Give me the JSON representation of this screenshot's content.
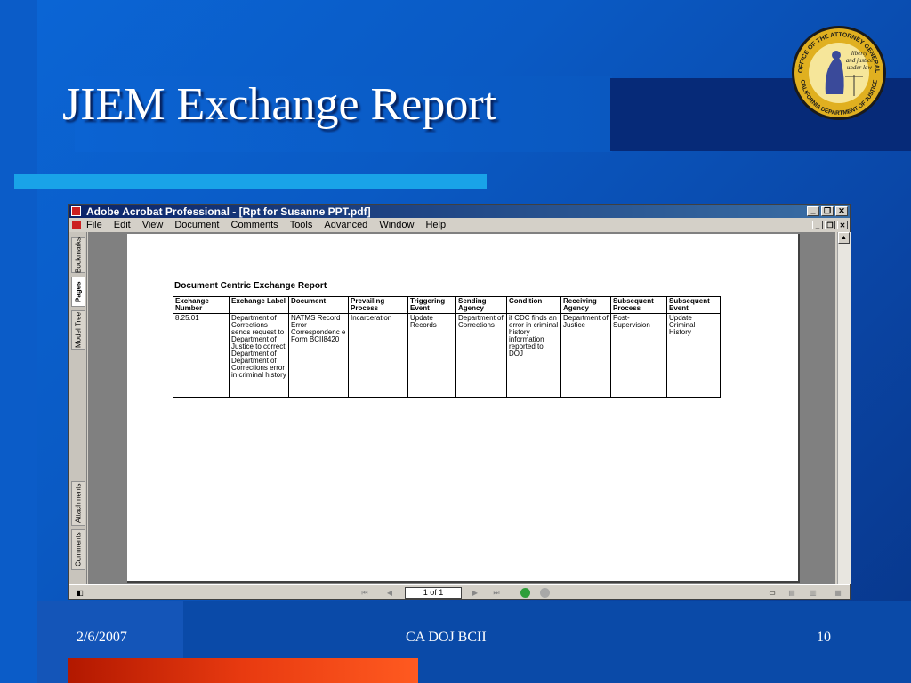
{
  "slide": {
    "title": "JIEM Exchange Report",
    "footer_date": "2/6/2007",
    "footer_center": "CA DOJ BCII",
    "footer_page": "10",
    "seal": {
      "outer_text": "OFFICE OF THE ATTORNEY GENERAL",
      "lower_text": "CALIFORNIA DEPARTMENT OF JUSTICE",
      "motto_1": "liberty",
      "motto_2": "and justice",
      "motto_3": "under law"
    }
  },
  "window": {
    "title": "Adobe Acrobat Professional - [Rpt for Susanne PPT.pdf]",
    "menu": [
      "File",
      "Edit",
      "View",
      "Document",
      "Comments",
      "Tools",
      "Advanced",
      "Window",
      "Help"
    ],
    "nav_tabs": [
      "Bookmarks",
      "Pages",
      "Model Tree",
      "Attachments",
      "Comments"
    ],
    "page_indicator": "1 of 1"
  },
  "report": {
    "title": "Document Centric Exchange Report",
    "headers": [
      "Exchange Number",
      "Exchange Label",
      "Document",
      "Prevailing Process",
      "Triggering Event",
      "Sending Agency",
      "Condition",
      "Receiving Agency",
      "Subsequent Process",
      "Subsequent Event"
    ],
    "row": [
      "8.25.01",
      "Department of Corrections sends request to Department of Justice to correct Department of Department of Corrections error in criminal history",
      "NATMS Record Error Correspondenc e Form BCII8420",
      "Incarceration",
      "Update Records",
      "Department of Corrections",
      "if CDC finds an error in criminal history information reported to DOJ",
      "Department of Justice",
      "Post-Supervision",
      "Update Criminal History"
    ]
  },
  "colors": {
    "slide_bg": "#0a5ac4",
    "accent_cyan": "#19a3e8",
    "accent_red": "#e83a10",
    "title_bar": "#0a246a"
  }
}
